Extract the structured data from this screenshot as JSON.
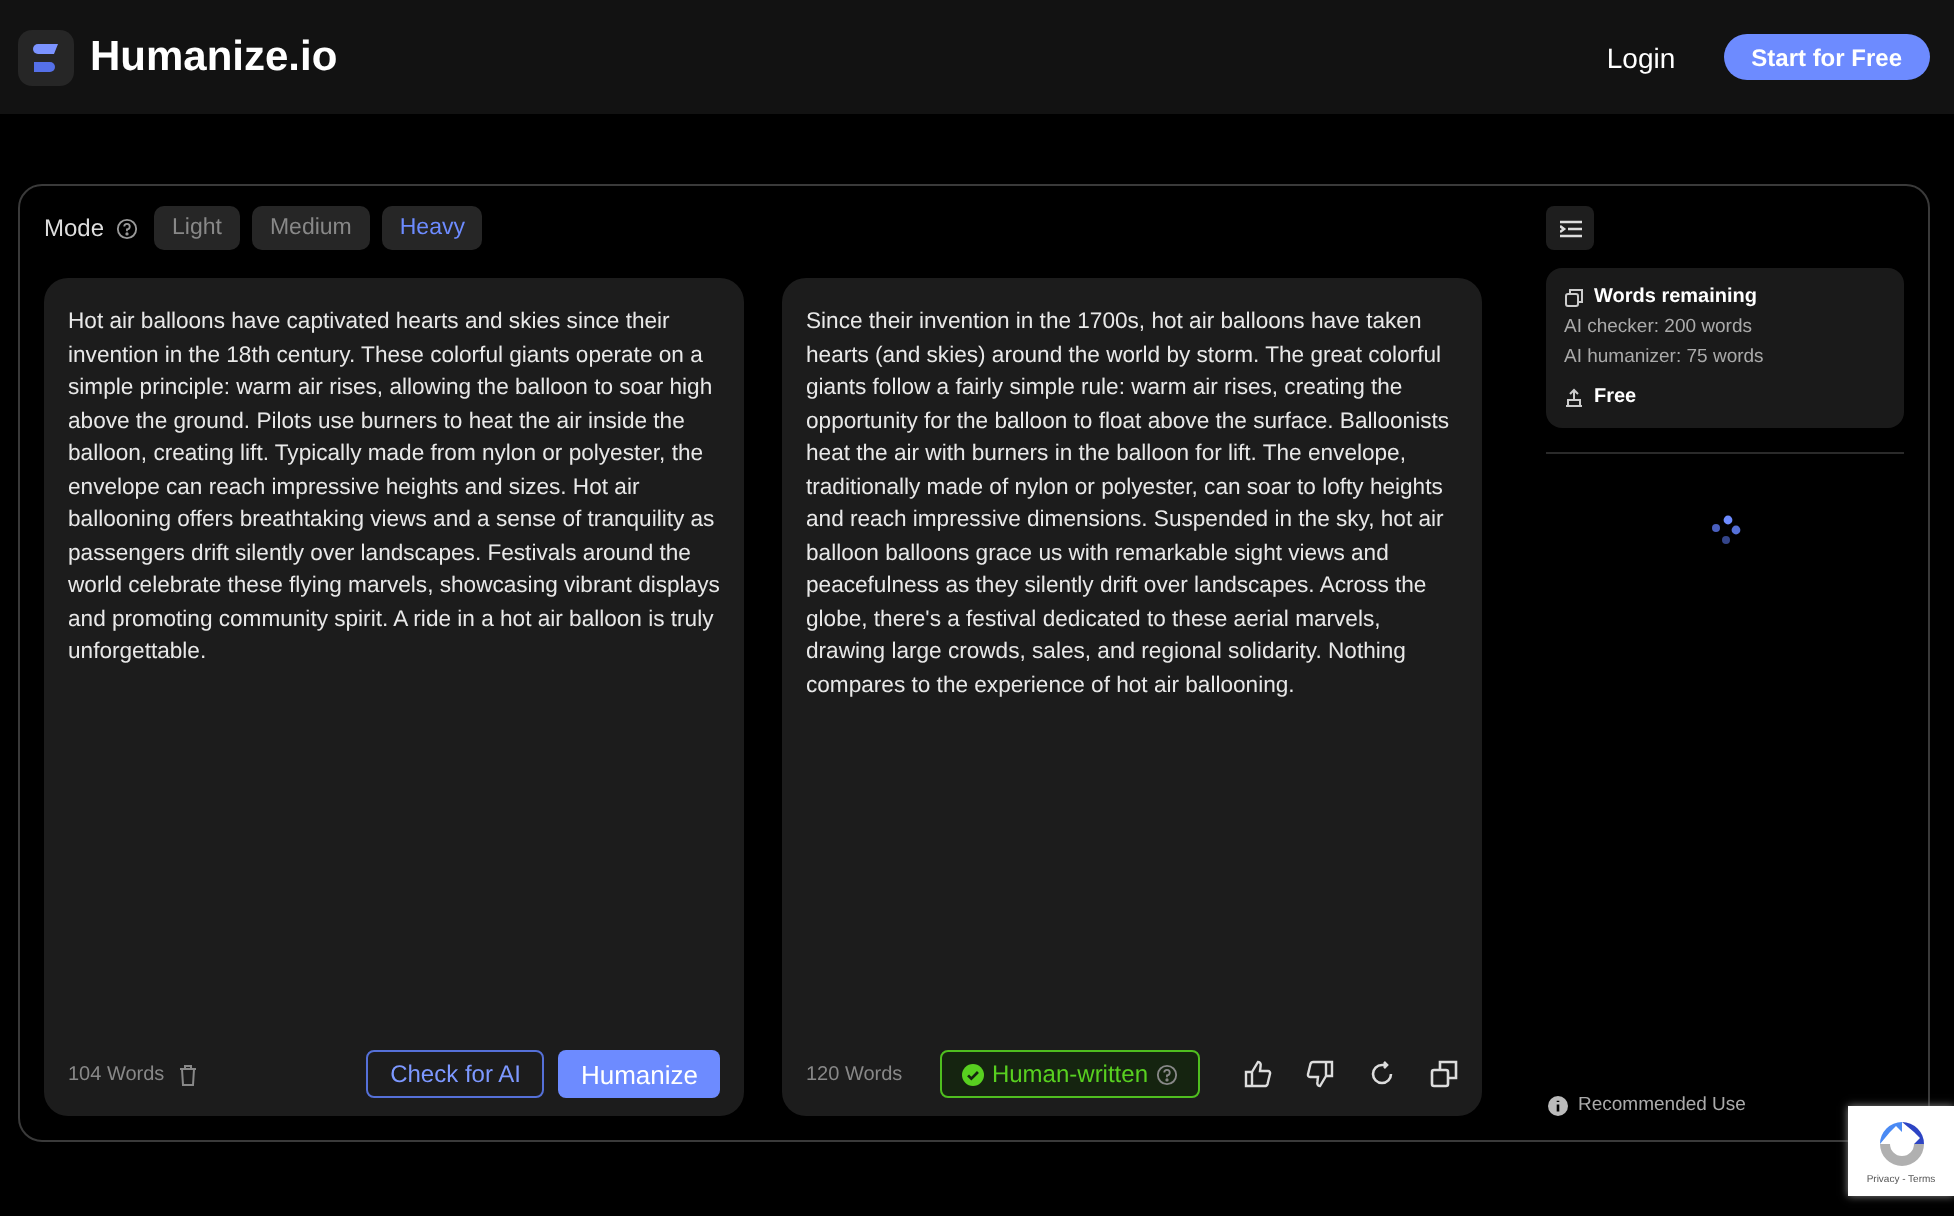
{
  "header": {
    "brand": "Humanize.io",
    "login": "Login",
    "cta": "Start for Free"
  },
  "mode": {
    "label": "Mode",
    "options": [
      {
        "label": "Light",
        "selected": false
      },
      {
        "label": "Medium",
        "selected": false
      },
      {
        "label": "Heavy",
        "selected": true
      }
    ]
  },
  "input_panel": {
    "text": "Hot air balloons have captivated hearts and skies since their invention in the 18th century. These colorful giants operate on a simple principle: warm air rises, allowing the balloon to soar high above the ground. Pilots use burners to heat the air inside the balloon, creating lift. Typically made from nylon or polyester, the envelope can reach impressive heights and sizes. Hot air ballooning offers breathtaking views and a sense of tranquility as passengers drift silently over landscapes. Festivals around the world celebrate these flying marvels, showcasing vibrant displays and promoting community spirit. A ride in a hot air balloon is truly unforgettable.",
    "word_count": "104 Words",
    "check_button": "Check for AI",
    "humanize_button": "Humanize"
  },
  "output_panel": {
    "text": "Since their invention in the 1700s, hot air balloons have taken hearts (and skies) around the world by storm. The great colorful giants follow a fairly simple rule: warm air rises, creating the opportunity for the balloon to float above the surface. Balloonists heat the air with burners in the balloon for lift. The envelope, traditionally made of nylon or polyester, can soar to lofty heights and reach impressive dimensions. Suspended in the sky, hot air balloon balloons grace us with remarkable sight views and peacefulness as they silently drift over landscapes. Across the globe, there's a festival dedicated to these aerial marvels, drawing large crowds, sales, and regional solidarity. Nothing compares to the experience of hot air ballooning.",
    "word_count": "120 Words",
    "verdict": "Human-written"
  },
  "sidebar": {
    "title": "Words remaining",
    "lines": [
      "AI checker: 200 words",
      "AI humanizer: 75 words"
    ],
    "plan": "Free",
    "recommended": "Recommended Use"
  },
  "recaptcha": {
    "text": "Privacy - Terms"
  }
}
